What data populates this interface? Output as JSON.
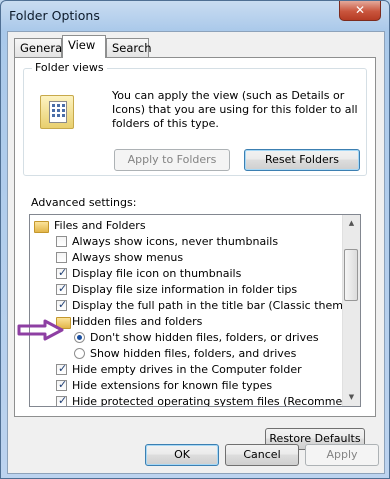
{
  "window": {
    "title": "Folder Options",
    "close_glyph": "✕"
  },
  "tabs": [
    {
      "label": "General",
      "active": false
    },
    {
      "label": "View",
      "active": true
    },
    {
      "label": "Search",
      "active": false
    }
  ],
  "folder_views": {
    "legend": "Folder views",
    "icon": "folder-view-icon",
    "description": "You can apply the view (such as Details or Icons) that you are using for this folder to all folders of this type.",
    "apply_label": "Apply to Folders",
    "reset_label": "Reset Folders"
  },
  "advanced": {
    "label": "Advanced settings:",
    "items": [
      {
        "kind": "folder",
        "label": "Files and Folders"
      },
      {
        "kind": "checkbox",
        "label": "Always show icons, never thumbnails",
        "checked": false
      },
      {
        "kind": "checkbox",
        "label": "Always show menus",
        "checked": false
      },
      {
        "kind": "checkbox",
        "label": "Display file icon on thumbnails",
        "checked": true
      },
      {
        "kind": "checkbox",
        "label": "Display file size information in folder tips",
        "checked": true
      },
      {
        "kind": "checkbox",
        "label": "Display the full path in the title bar (Classic theme only)",
        "checked": true
      },
      {
        "kind": "folder",
        "label": "Hidden files and folders"
      },
      {
        "kind": "radio",
        "label": "Don't show hidden files, folders, or drives",
        "checked": true
      },
      {
        "kind": "radio",
        "label": "Show hidden files, folders, and drives",
        "checked": false
      },
      {
        "kind": "checkbox",
        "label": "Hide empty drives in the Computer folder",
        "checked": true
      },
      {
        "kind": "checkbox",
        "label": "Hide extensions for known file types",
        "checked": true
      },
      {
        "kind": "checkbox",
        "label": "Hide protected operating system files (Recommended)",
        "checked": true
      }
    ],
    "restore_label": "Restore Defaults"
  },
  "footer": {
    "ok_label": "OK",
    "cancel_label": "Cancel",
    "apply_label": "Apply"
  },
  "annotation": {
    "arrow_color": "#8e3fa3"
  }
}
